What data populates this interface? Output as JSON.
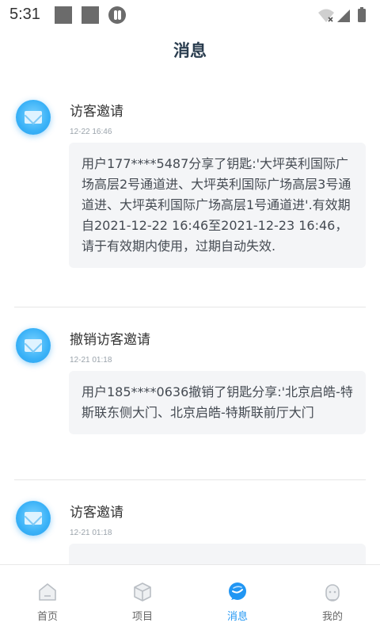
{
  "status_bar": {
    "time": "5:31"
  },
  "header": {
    "title": "消息"
  },
  "messages": [
    {
      "title": "访客邀请",
      "time": "12-22 16:46",
      "body": "用户177****5487分享了钥匙:'大坪英利国际广场高层2号通道进、大坪英利国际广场高层3号通道进、大坪英利国际广场高层1号通道进'.有效期自2021-12-22 16:46至2021-12-23 16:46，请于有效期内使用，过期自动失效."
    },
    {
      "title": "撤销访客邀请",
      "time": "12-21 01:18",
      "body": "用户185****0636撤销了钥匙分享:'北京启皓-特斯联东侧大门、北京启皓-特斯联前厅大门"
    },
    {
      "title": "访客邀请",
      "time": "12-21 01:18",
      "body": ""
    }
  ],
  "tabs": [
    {
      "label": "首页",
      "icon": "home-icon",
      "active": false
    },
    {
      "label": "项目",
      "icon": "cube-icon",
      "active": false
    },
    {
      "label": "消息",
      "icon": "message-icon",
      "active": true
    },
    {
      "label": "我的",
      "icon": "profile-icon",
      "active": false
    }
  ],
  "colors": {
    "accent": "#2196f3",
    "title": "#2a3d4f",
    "bubble": "#f4f5f7",
    "avatar": "#39b1f7"
  }
}
